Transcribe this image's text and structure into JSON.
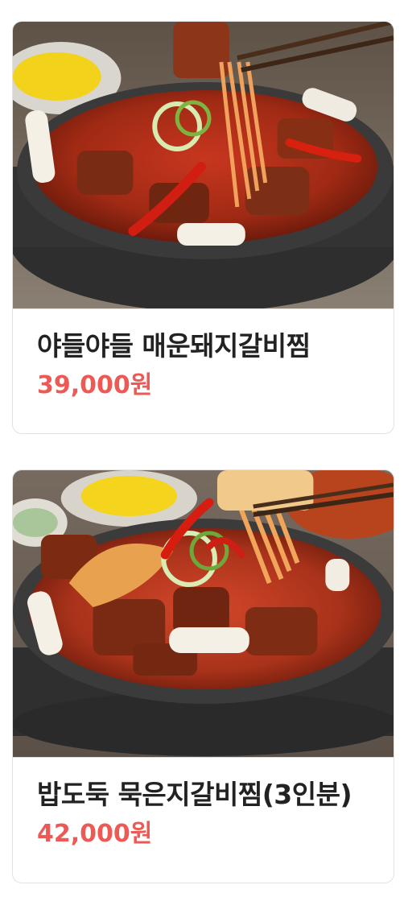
{
  "products": [
    {
      "name": "야들야들 매운돼지갈비찜",
      "price": "39,000원",
      "image_icon": "food-photo-icon"
    },
    {
      "name": "밥도둑 묵은지갈비찜(3인분)",
      "price": "42,000원",
      "image_icon": "food-photo-icon"
    }
  ],
  "colors": {
    "price": "#ed5a55",
    "name": "#222222",
    "border": "#e2e2e2"
  }
}
